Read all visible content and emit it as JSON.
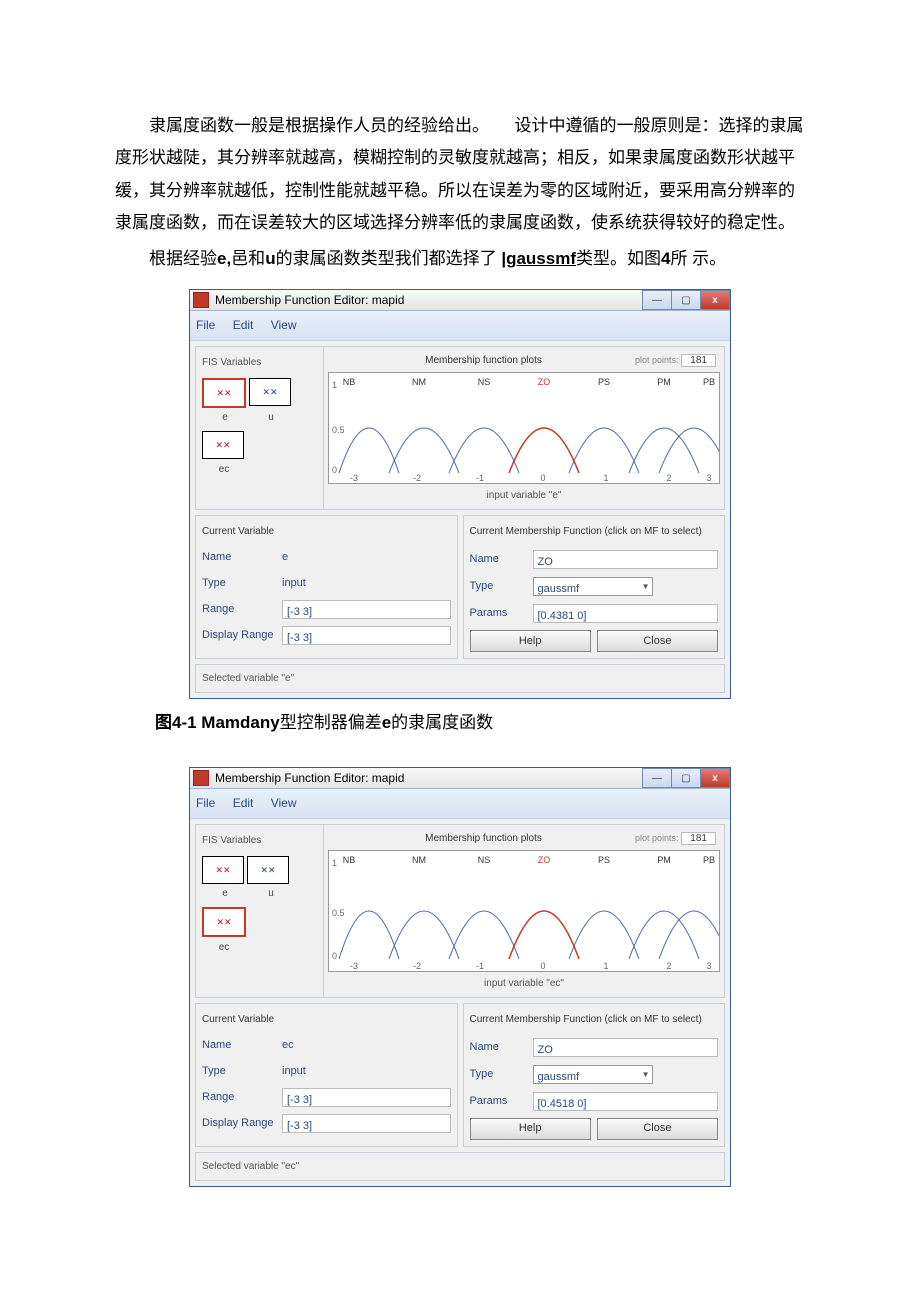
{
  "doc": {
    "p1": "隶属度函数一般是根据操作人员的经验给出。　　设计中遵循的一般原则是：选择的隶属度形状越陡，其分辨率就越高，模糊控制的灵敏度就越高；相反，如果隶属度函数形状越平缓，其分辨率就越低，控制性能就越平稳。所以在误差为零的区域附近，要采用高分辨率的隶属度函数，而在误差较大的区域选择分辨率低的隶属度函数，使系统获得较好的稳定性。",
    "p2_a": "根据经验",
    "p2_b": "e,",
    "p2_c": "邑和",
    "p2_d": "u",
    "p2_e": "的隶属函数类型我们都选择了 ",
    "p2_f": "|gaussmf",
    "p2_g": "类型。如图",
    "p2_h": "4",
    "p2_i": "所 示。",
    "cap1_a": "图",
    "cap1_b": "4-1 Mamdany",
    "cap1_c": "型控制器偏差",
    "cap1_d": "e",
    "cap1_e": "的隶属度函数"
  },
  "win": {
    "title": "Membership Function Editor: mapid",
    "menu": {
      "file": "File",
      "edit": "Edit",
      "view": "View"
    },
    "fis_label": "FIS Variables",
    "vars": {
      "e": "e",
      "u": "u",
      "ec": "ec"
    },
    "plot_title": "Membership function plots",
    "plot_points_lbl": "plot points:",
    "plot_points_val": "181",
    "mf_labels": [
      "NB",
      "NM",
      "NS",
      "ZO",
      "PS",
      "PM",
      "PB"
    ],
    "ticks": [
      "-3",
      "-2",
      "-1",
      "0",
      "1",
      "2",
      "3"
    ],
    "cv": {
      "head": "Current Variable",
      "name_l": "Name",
      "type_l": "Type",
      "range_l": "Range",
      "drange_l": "Display Range"
    },
    "mf": {
      "head": "Current Membership Function (click on MF to select)",
      "name_l": "Name",
      "type_l": "Type",
      "params_l": "Params"
    },
    "btn": {
      "help": "Help",
      "close": "Close"
    }
  },
  "p1": {
    "xlabel": "input variable \"e\"",
    "cv": {
      "name": "e",
      "type": "input",
      "range": "[-3 3]",
      "drange": "[-3 3]"
    },
    "mf": {
      "name": "ZO",
      "type": "gaussmf",
      "params": "[0.4381 0]"
    },
    "status": "Selected variable \"e\""
  },
  "p2": {
    "xlabel": "input variable \"ec\"",
    "cv": {
      "name": "ec",
      "type": "input",
      "range": "[-3 3]",
      "drange": "[-3 3]"
    },
    "mf": {
      "name": "ZO",
      "type": "gaussmf",
      "params": "[0.4518 0]"
    },
    "status": "Selected variable \"ec\""
  }
}
